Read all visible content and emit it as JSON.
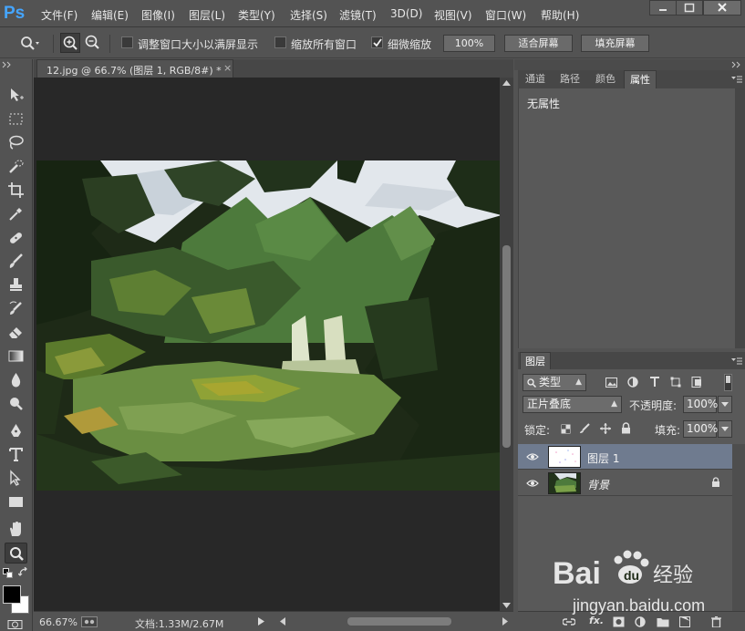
{
  "app": {
    "logo": "Ps"
  },
  "menu": [
    "文件(F)",
    "编辑(E)",
    "图像(I)",
    "图层(L)",
    "类型(Y)",
    "选择(S)",
    "滤镜(T)",
    "3D(D)",
    "视图(V)",
    "窗口(W)",
    "帮助(H)"
  ],
  "options": {
    "resize_windows": "调整窗口大小以满屏显示",
    "resize_windows_checked": false,
    "zoom_all_windows": "缩放所有窗口",
    "zoom_all_windows_checked": false,
    "scrubby_zoom": "细微缩放",
    "scrubby_zoom_checked": true,
    "btn_100": "100%",
    "btn_fit": "适合屏幕",
    "btn_fill": "填充屏幕"
  },
  "document": {
    "tab_title": "12.jpg @ 66.7% (图层 1, RGB/8#) *",
    "tab_close": "×",
    "zoom": "66.67%",
    "doc_size": "文档:1.33M/2.67M"
  },
  "properties_panel": {
    "tabs": [
      "通道",
      "路径",
      "颜色",
      "属性"
    ],
    "active_tab": "属性",
    "content": "无属性"
  },
  "layers_panel": {
    "tab": "图层",
    "filter_kind": "类型",
    "blend_mode": "正片叠底",
    "opacity_label": "不透明度:",
    "opacity": "100%",
    "lock_label": "锁定:",
    "fill_label": "填充:",
    "fill": "100%",
    "layers": [
      {
        "name": "图层 1",
        "visible": true,
        "selected": true
      },
      {
        "name": "背景",
        "visible": true,
        "selected": false,
        "locked": true
      }
    ]
  },
  "watermark": {
    "brand": "Bai",
    "brand_cn": "经验",
    "url": "jingyan.baidu.com"
  },
  "colors": {
    "ui_bg": "#535353",
    "canvas_bg": "#282828",
    "selected_layer": "#6f7b8f",
    "ps_blue": "#45a5ff"
  }
}
